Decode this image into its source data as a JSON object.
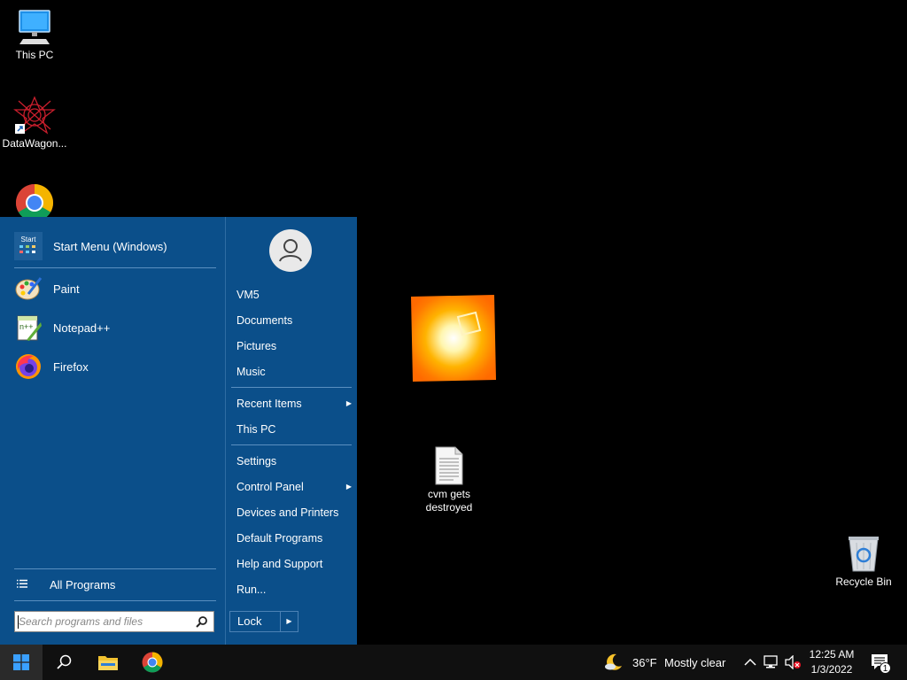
{
  "desktop": {
    "icons": [
      {
        "label": "This PC"
      },
      {
        "label": "DataWagon..."
      },
      {
        "label": "cvm gets destroyed"
      },
      {
        "label": "Recycle Bin"
      }
    ]
  },
  "start_menu": {
    "header_item": {
      "label": "Start Menu (Windows)",
      "icon_text": "Start"
    },
    "pinned": [
      {
        "label": "Paint",
        "icon": "paint-icon"
      },
      {
        "label": "Notepad++",
        "icon": "notepadpp-icon"
      },
      {
        "label": "Firefox",
        "icon": "firefox-icon"
      }
    ],
    "all_programs": "All Programs",
    "search_placeholder": "Search programs and files",
    "right_items": [
      {
        "label": "VM5"
      },
      {
        "label": "Documents"
      },
      {
        "label": "Pictures"
      },
      {
        "label": "Music"
      },
      {
        "label": "Recent Items"
      },
      {
        "label": "This PC"
      },
      {
        "label": "Settings"
      },
      {
        "label": "Control Panel"
      },
      {
        "label": "Devices and Printers"
      },
      {
        "label": "Default Programs"
      },
      {
        "label": "Help and Support"
      },
      {
        "label": "Run..."
      }
    ],
    "lock_label": "Lock"
  },
  "taskbar": {
    "weather_temp": "36°F",
    "weather_desc": "Mostly clear",
    "time": "12:25 AM",
    "date": "1/3/2022",
    "notification_count": "1"
  },
  "colors": {
    "start_menu_bg": "#0b4f8a",
    "taskbar_bg": "#101010",
    "desktop_bg": "#000000"
  }
}
